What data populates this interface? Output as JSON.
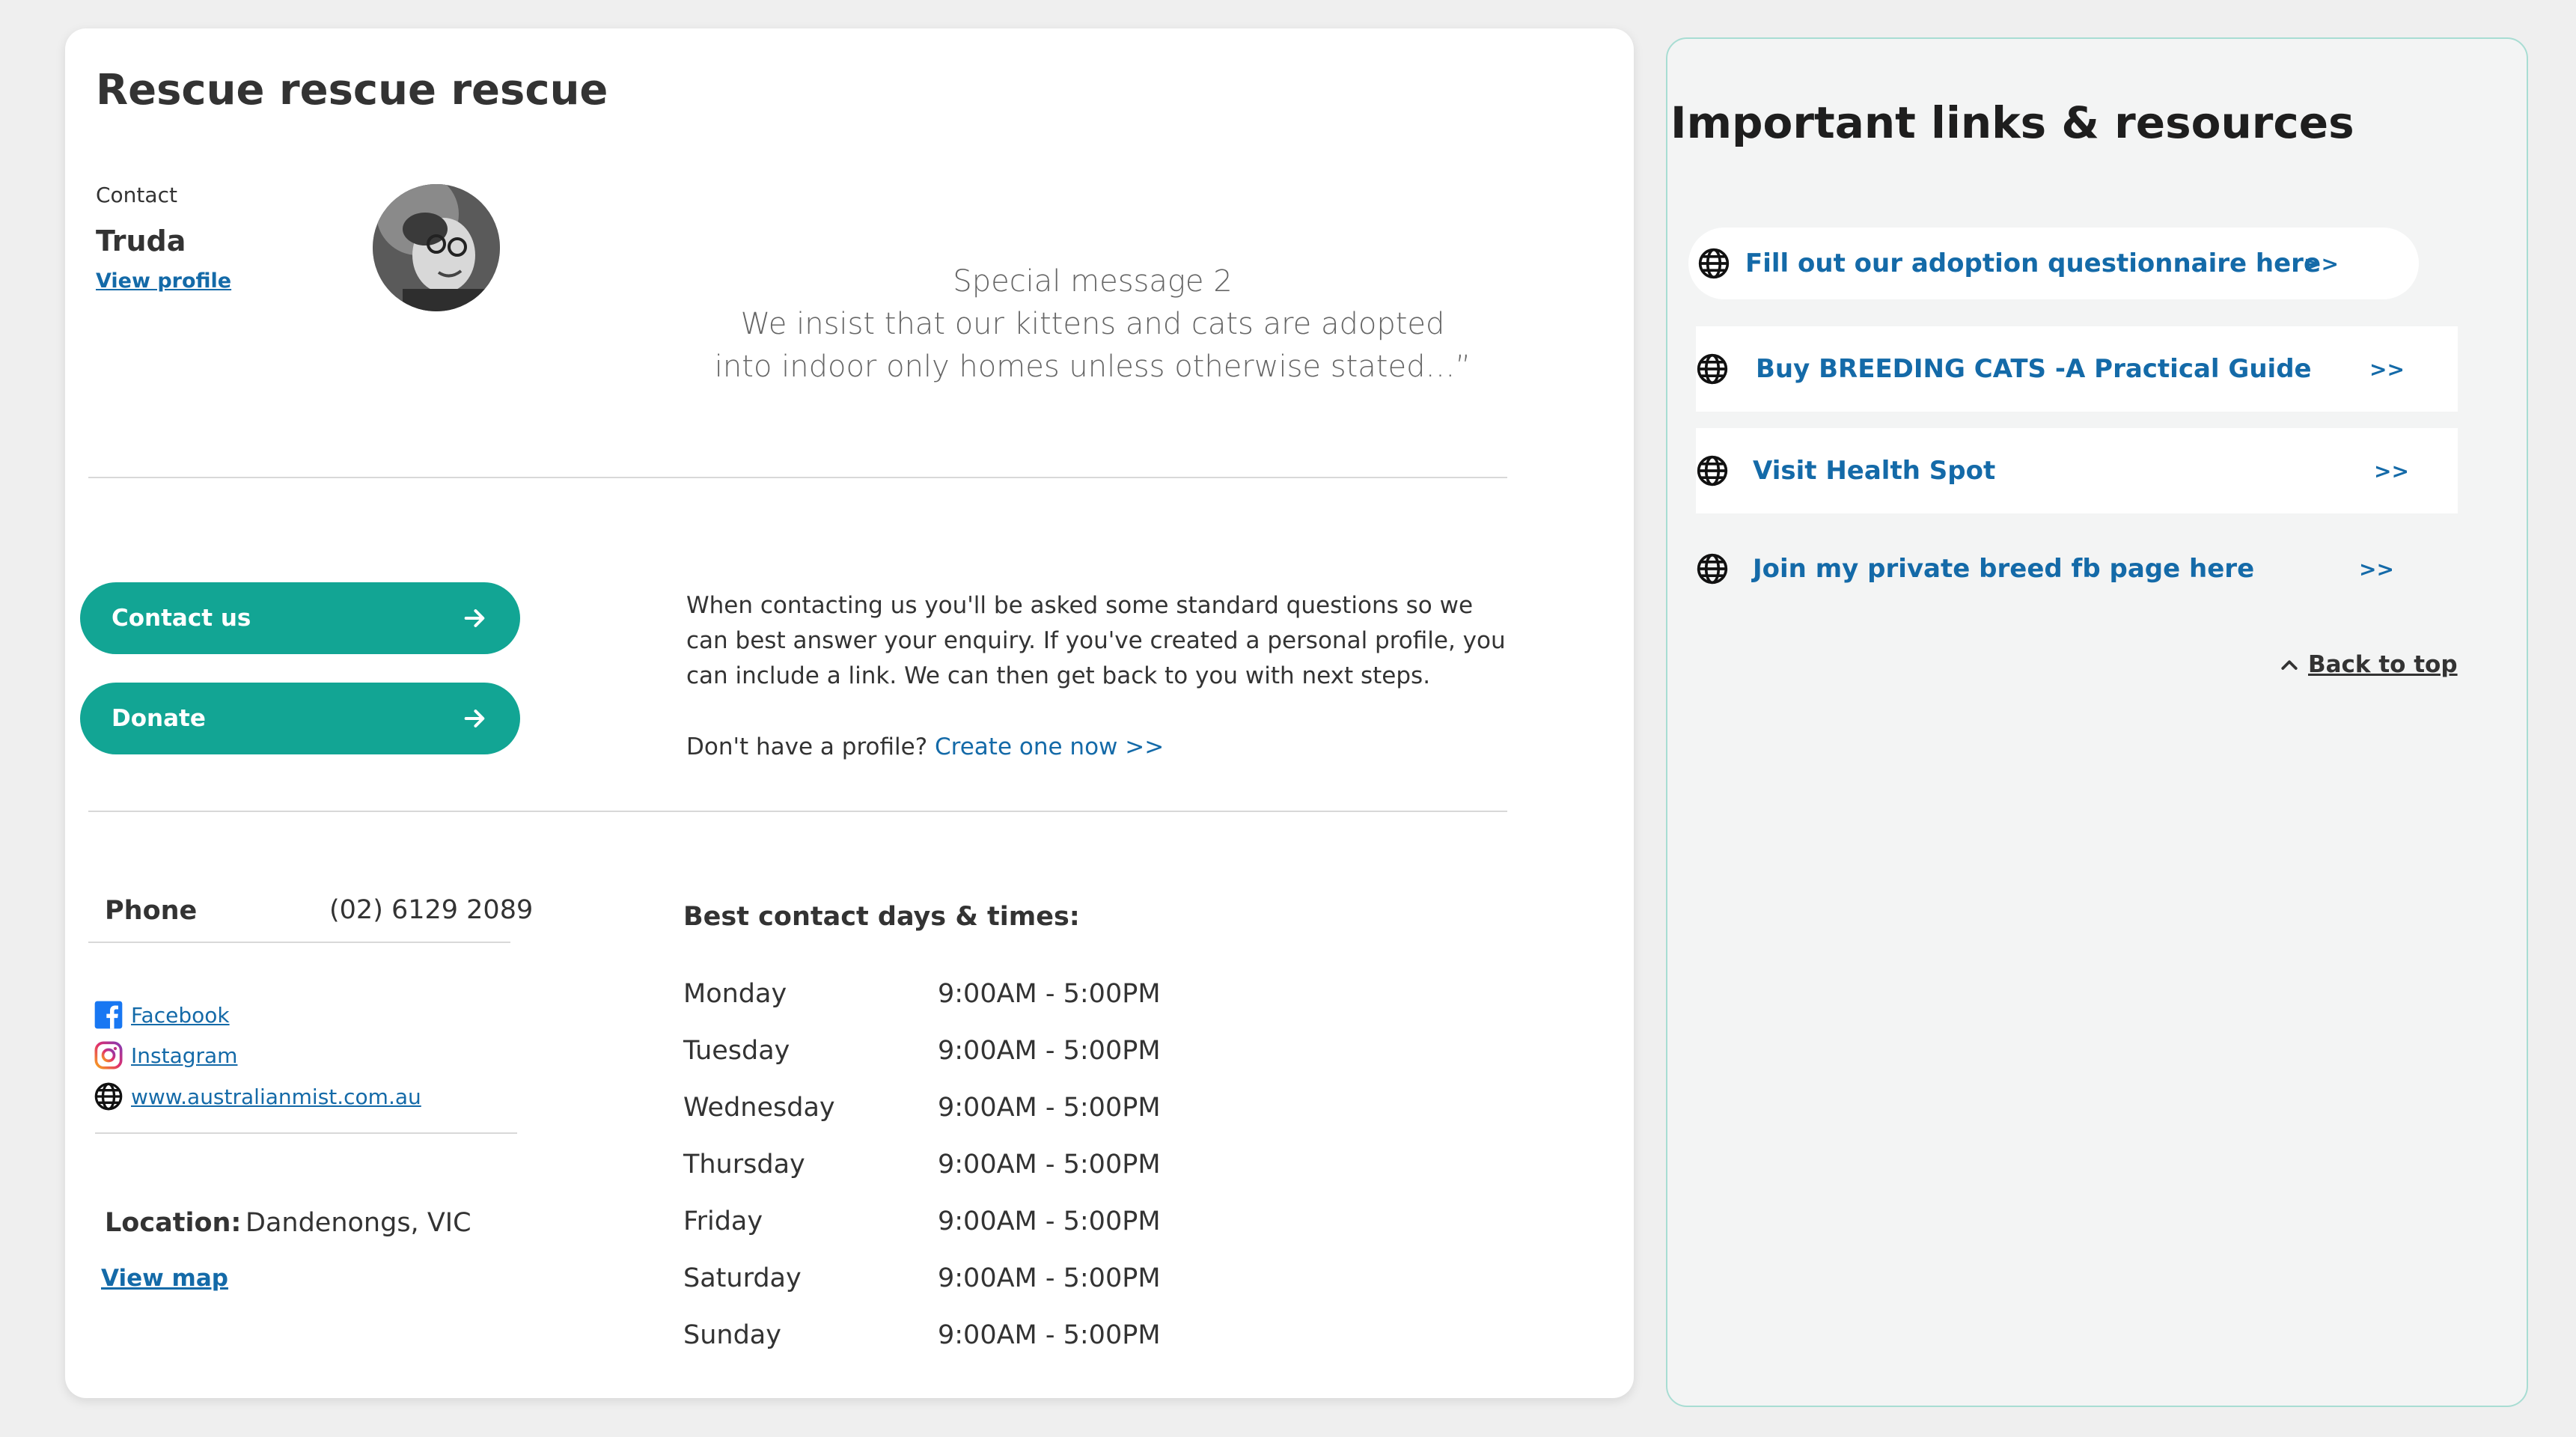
{
  "profile": {
    "title": "Rescue rescue rescue",
    "contact_label": "Contact",
    "contact_name": "Truda",
    "view_profile": "View profile",
    "special_message": [
      "Special message 2",
      "We insist that our kittens and cats are adopted",
      "into indoor only homes unless otherwise stated…”"
    ]
  },
  "actions": {
    "contact_label": "Contact us",
    "donate_label": "Donate"
  },
  "enquiry": {
    "text": "When contacting us you'll be asked some standard questions so we can best answer your enquiry.  If you've created a personal profile, you can include a link.  We can then get back to you with next steps.",
    "no_profile": "Don't have a profile?",
    "create_link": "Create one now >>"
  },
  "details": {
    "phone_label": "Phone",
    "phone_value": "(02) 6129 2089",
    "facebook": "Facebook",
    "instagram": "Instagram",
    "website": "www.australianmist.com.au",
    "location_label": "Location:",
    "location_value": "Dandenongs, VIC",
    "view_map": "View map"
  },
  "hours": {
    "title": "Best contact days & times:",
    "rows": [
      {
        "day": "Monday",
        "time": "9:00AM - 5:00PM"
      },
      {
        "day": "Tuesday",
        "time": "9:00AM - 5:00PM"
      },
      {
        "day": "Wednesday",
        "time": "9:00AM - 5:00PM"
      },
      {
        "day": "Thursday",
        "time": "9:00AM - 5:00PM"
      },
      {
        "day": "Friday",
        "time": "9:00AM - 5:00PM"
      },
      {
        "day": "Saturday",
        "time": "9:00AM - 5:00PM"
      },
      {
        "day": "Sunday",
        "time": "9:00AM - 5:00PM"
      }
    ]
  },
  "resources": {
    "title": "Important links & resources",
    "items": [
      {
        "label": "Fill out our adoption questionnaire here",
        "chevron": ">>"
      },
      {
        "label": "Buy BREEDING CATS  -A Practical Guide",
        "chevron": ">>"
      },
      {
        "label": "Visit Health Spot",
        "chevron": ">>"
      },
      {
        "label": "Join my private breed fb page here",
        "chevron": ">>"
      }
    ],
    "back_to_top": "Back to top"
  },
  "colors": {
    "accent_teal": "#12a594",
    "link_blue": "#146aa8",
    "panel_border": "#a8ddd3"
  }
}
